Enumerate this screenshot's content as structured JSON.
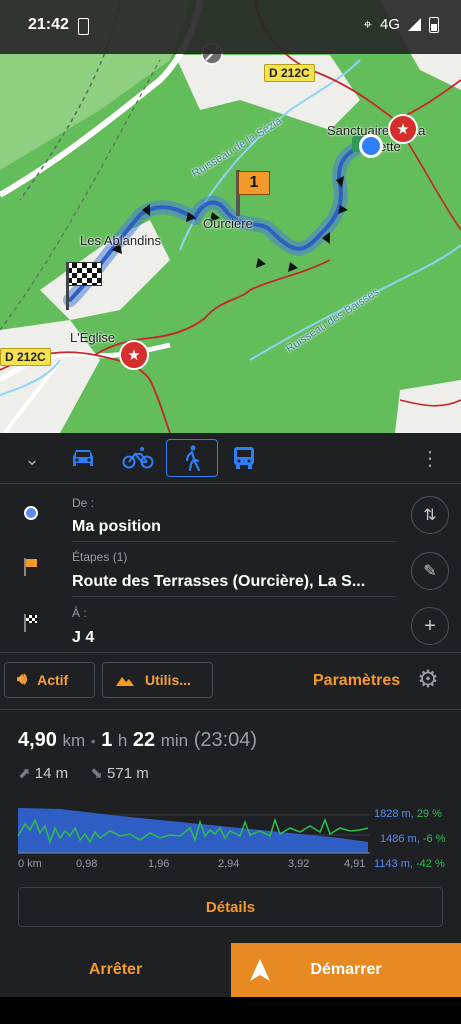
{
  "status_bar": {
    "time": "21:42",
    "network": "4G"
  },
  "map": {
    "road_label_top": "D 212C",
    "road_label_left": "D 212C",
    "places": [
      "Sanctuaire de La",
      "ette",
      "Ruisseau de la Sézia",
      "Ourcière",
      "Les Ablandins",
      "L'Église",
      "Ruisseau des Baisses"
    ],
    "waypoint_number": "1"
  },
  "modes": {
    "active": "pedestrian",
    "list": [
      "car-icon",
      "bicycle-icon",
      "pedestrian-icon",
      "bus-icon"
    ]
  },
  "route": {
    "from_label": "De :",
    "from_value": "Ma position",
    "via_label": "Étapes (1)",
    "via_value": "Route des Terrasses (Ourcière), La S...",
    "to_label": "À :",
    "to_value": "J 4"
  },
  "options": {
    "sound_label": "Actif",
    "terrain_label": "Utilis...",
    "params_label": "Paramètres"
  },
  "summary": {
    "distance_value": "4,90",
    "distance_unit": "km",
    "hours": "1",
    "hours_unit": "h",
    "minutes": "22",
    "minutes_unit": "min",
    "arrival": "(23:04)",
    "ascent": "14 m",
    "descent": "571 m"
  },
  "elevation": {
    "axis_ticks": [
      "0 km",
      "0,98",
      "1,96",
      "2,94",
      "3,92",
      "4,91"
    ],
    "right_labels": [
      {
        "alt": "1828 m,",
        "slope": "29 %"
      },
      {
        "alt": "1486 m,",
        "slope": "-6 %"
      },
      {
        "alt": "1143 m,",
        "slope": "-42 %"
      }
    ],
    "colors": {
      "altitude": "#3a6fd8",
      "slope": "#2fbf4a"
    }
  },
  "details_label": "Détails",
  "stop_label": "Arrêter",
  "start_label": "Démarrer",
  "colors": {
    "accent": "#f39a2b",
    "active_mode": "#2f7ef6"
  }
}
